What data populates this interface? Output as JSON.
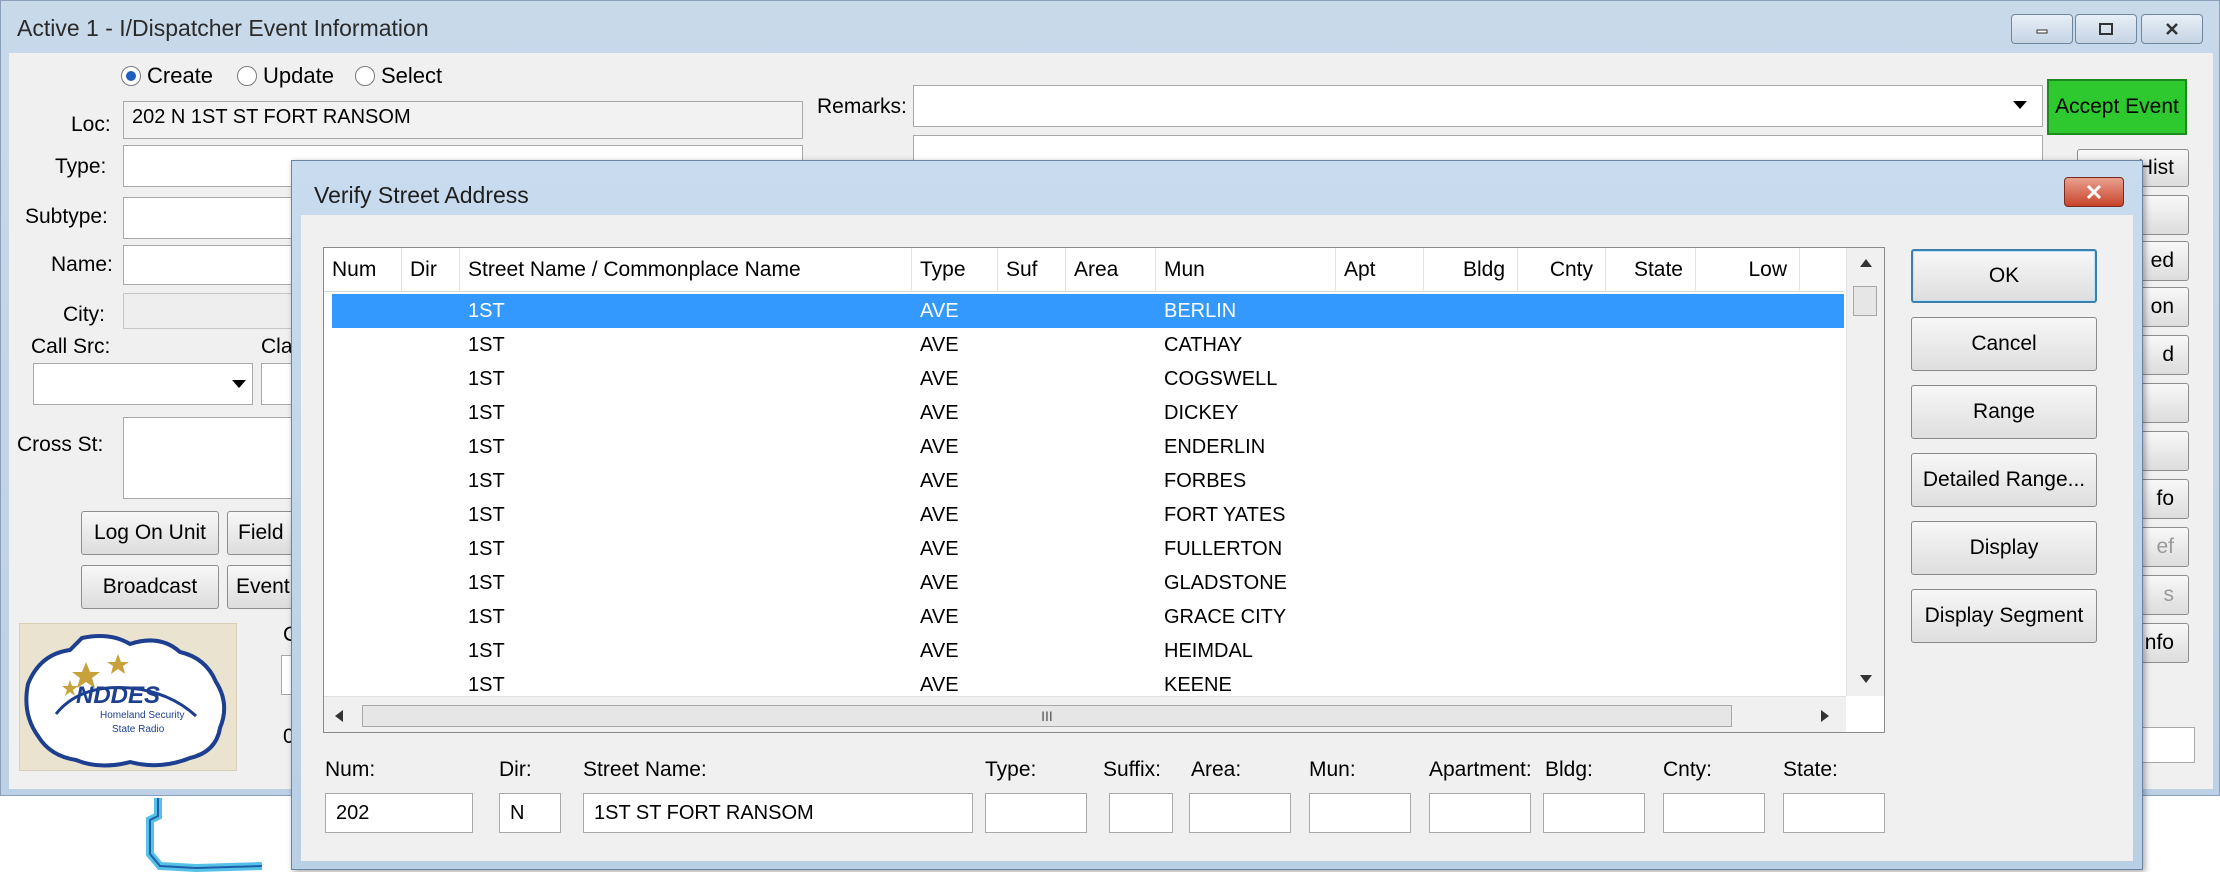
{
  "main_window": {
    "title": "Active 1 - I/Dispatcher Event Information",
    "mode_options": [
      {
        "label": "Create",
        "selected": true
      },
      {
        "label": "Update",
        "selected": false
      },
      {
        "label": "Select",
        "selected": false
      }
    ],
    "labels": {
      "loc": "Loc:",
      "type": "Type:",
      "subtype": "Subtype:",
      "name": "Name:",
      "city": "City:",
      "call_src": "Call Src:",
      "cla_partial": "Cla",
      "cross_st": "Cross St:",
      "remarks": "Remarks:"
    },
    "loc_value": "202 N 1ST ST FORT RANSOM",
    "remarks_value": "",
    "buttons": {
      "accept_event": "Accept Event",
      "log_on_unit": "Log On Unit",
      "field_partial": "Field",
      "broadcast": "Broadcast",
      "event_partial": "Event"
    },
    "right_buttons_partial": [
      "Hist",
      "",
      "ed",
      "on",
      "d",
      "",
      "",
      "fo",
      "ef",
      "s",
      "nfo"
    ],
    "logo_text": {
      "name": "NDDES",
      "line1": "Homeland Security",
      "line2": "State Radio"
    },
    "partial_letters": {
      "left_c": "C",
      "left_0": "0"
    }
  },
  "dialog": {
    "title": "Verify Street Address",
    "columns": [
      "Num",
      "Dir",
      "Street Name / Commonplace Name",
      "Type",
      "Suf",
      "Area",
      "Mun",
      "Apt",
      "Bldg",
      "Cnty",
      "State",
      "Low"
    ],
    "rows": [
      {
        "num": "",
        "dir": "",
        "street": "1ST",
        "type": "AVE",
        "suf": "",
        "area": "",
        "mun": "BERLIN",
        "selected": true
      },
      {
        "num": "",
        "dir": "",
        "street": "1ST",
        "type": "AVE",
        "suf": "",
        "area": "",
        "mun": "CATHAY",
        "selected": false
      },
      {
        "num": "",
        "dir": "",
        "street": "1ST",
        "type": "AVE",
        "suf": "",
        "area": "",
        "mun": "COGSWELL",
        "selected": false
      },
      {
        "num": "",
        "dir": "",
        "street": "1ST",
        "type": "AVE",
        "suf": "",
        "area": "",
        "mun": "DICKEY",
        "selected": false
      },
      {
        "num": "",
        "dir": "",
        "street": "1ST",
        "type": "AVE",
        "suf": "",
        "area": "",
        "mun": "ENDERLIN",
        "selected": false
      },
      {
        "num": "",
        "dir": "",
        "street": "1ST",
        "type": "AVE",
        "suf": "",
        "area": "",
        "mun": "FORBES",
        "selected": false
      },
      {
        "num": "",
        "dir": "",
        "street": "1ST",
        "type": "AVE",
        "suf": "",
        "area": "",
        "mun": "FORT YATES",
        "selected": false
      },
      {
        "num": "",
        "dir": "",
        "street": "1ST",
        "type": "AVE",
        "suf": "",
        "area": "",
        "mun": "FULLERTON",
        "selected": false
      },
      {
        "num": "",
        "dir": "",
        "street": "1ST",
        "type": "AVE",
        "suf": "",
        "area": "",
        "mun": "GLADSTONE",
        "selected": false
      },
      {
        "num": "",
        "dir": "",
        "street": "1ST",
        "type": "AVE",
        "suf": "",
        "area": "",
        "mun": "GRACE CITY",
        "selected": false
      },
      {
        "num": "",
        "dir": "",
        "street": "1ST",
        "type": "AVE",
        "suf": "",
        "area": "",
        "mun": "HEIMDAL",
        "selected": false
      },
      {
        "num": "",
        "dir": "",
        "street": "1ST",
        "type": "AVE",
        "suf": "",
        "area": "",
        "mun": "KEENE",
        "selected": false
      }
    ],
    "scroll_grip": "III",
    "buttons": {
      "ok": "OK",
      "cancel": "Cancel",
      "range": "Range",
      "detailed_range": "Detailed Range...",
      "display": "Display",
      "display_segment": "Display Segment"
    },
    "fields": [
      {
        "label": "Num:",
        "value": "202"
      },
      {
        "label": "Dir:",
        "value": "N"
      },
      {
        "label": "Street Name:",
        "value": "1ST ST FORT RANSOM"
      },
      {
        "label": "Type:",
        "value": ""
      },
      {
        "label": "Suffix:",
        "value": ""
      },
      {
        "label": "Area:",
        "value": ""
      },
      {
        "label": "Mun:",
        "value": ""
      },
      {
        "label": "Apartment:",
        "value": ""
      },
      {
        "label": "Bldg:",
        "value": ""
      },
      {
        "label": "Cnty:",
        "value": ""
      },
      {
        "label": "State:",
        "value": ""
      }
    ]
  },
  "colors": {
    "selection": "#3399ff",
    "accept_green": "#2ec92e",
    "title_gradient": "#c8d9ea",
    "close_red": "#c8432a"
  }
}
